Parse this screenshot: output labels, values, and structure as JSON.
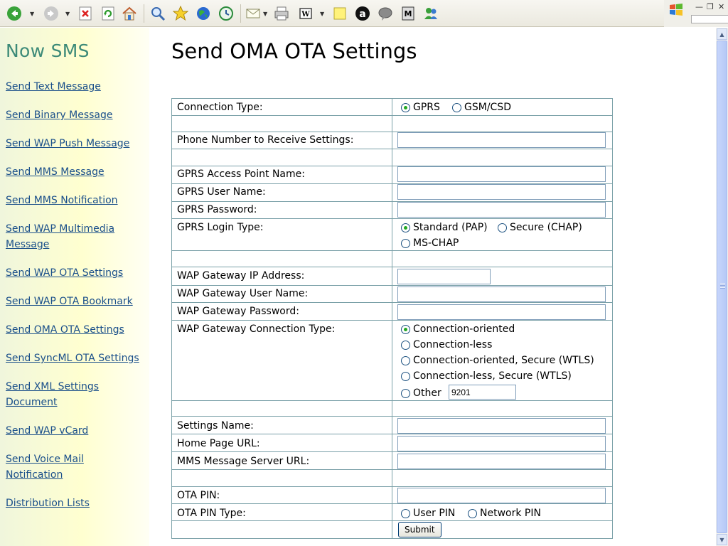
{
  "brand": "Now SMS",
  "title": "Send OMA OTA Settings",
  "nav": [
    {
      "label": "Send Text Message"
    },
    {
      "label": "Send Binary Message"
    },
    {
      "label": "Send WAP Push Message"
    },
    {
      "label": "Send MMS Message"
    },
    {
      "label": "Send MMS Notification"
    },
    {
      "label": "Send WAP Multimedia Message"
    },
    {
      "label": "Send WAP OTA Settings"
    },
    {
      "label": "Send WAP OTA Bookmark"
    },
    {
      "label": "Send OMA OTA Settings"
    },
    {
      "label": "Send SyncML OTA Settings"
    },
    {
      "label": "Send XML Settings Document"
    },
    {
      "label": "Send WAP vCard"
    },
    {
      "label": "Send Voice Mail Notification"
    },
    {
      "label": "Distribution Lists"
    }
  ],
  "form": {
    "connection_type": {
      "label": "Connection Type:",
      "options": [
        "GPRS",
        "GSM/CSD"
      ],
      "selected": "GPRS"
    },
    "phone_number": {
      "label": "Phone Number to Receive Settings:",
      "value": ""
    },
    "gprs_apn": {
      "label": "GPRS Access Point Name:",
      "value": ""
    },
    "gprs_user": {
      "label": "GPRS User Name:",
      "value": ""
    },
    "gprs_password": {
      "label": "GPRS Password:",
      "value": ""
    },
    "gprs_login_type": {
      "label": "GPRS Login Type:",
      "options": [
        "Standard (PAP)",
        "Secure (CHAP)",
        "MS-CHAP"
      ],
      "selected": "Standard (PAP)"
    },
    "wap_gateway_ip": {
      "label": "WAP Gateway IP Address:",
      "value": ""
    },
    "wap_gateway_user": {
      "label": "WAP Gateway User Name:",
      "value": ""
    },
    "wap_gateway_password": {
      "label": "WAP Gateway Password:",
      "value": ""
    },
    "wap_gateway_conn_type": {
      "label": "WAP Gateway Connection Type:",
      "options": [
        "Connection-oriented",
        "Connection-less",
        "Connection-oriented, Secure (WTLS)",
        "Connection-less, Secure (WTLS)",
        "Other"
      ],
      "selected": "Connection-oriented",
      "other_value": "9201"
    },
    "settings_name": {
      "label": "Settings Name:",
      "value": ""
    },
    "home_page_url": {
      "label": "Home Page URL:",
      "value": ""
    },
    "mms_server_url": {
      "label": "MMS Message Server URL:",
      "value": ""
    },
    "ota_pin": {
      "label": "OTA PIN:",
      "value": ""
    },
    "ota_pin_type": {
      "label": "OTA PIN Type:",
      "options": [
        "User PIN",
        "Network PIN"
      ],
      "selected": ""
    },
    "submit_label": "Submit"
  },
  "colors": {
    "brand": "#3c8a78",
    "link": "#1a4f8a",
    "border": "#7aa0a8"
  }
}
